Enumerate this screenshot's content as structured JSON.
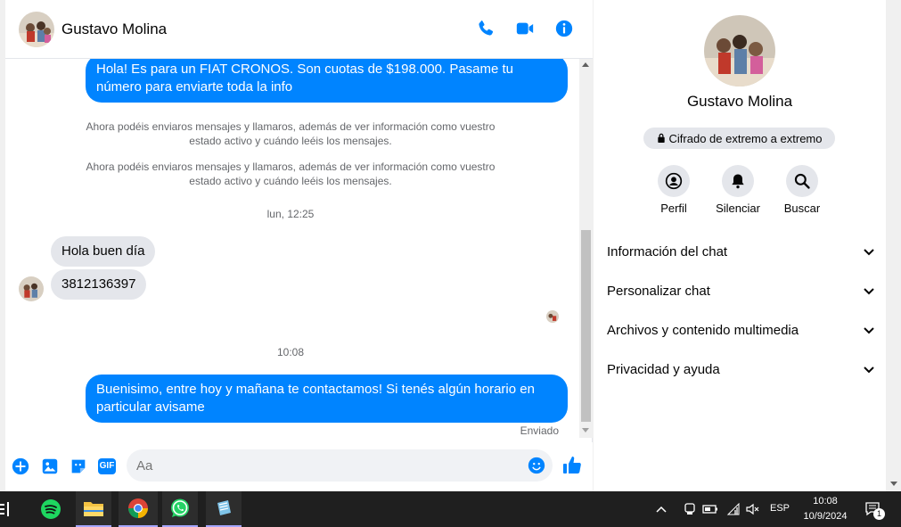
{
  "contact": {
    "name": "Gustavo Molina"
  },
  "header": {
    "icons": [
      "phone-icon",
      "video-camera-icon",
      "info-icon"
    ]
  },
  "messages": {
    "out1": "Hola! Es para un FIAT CRONOS. Son cuotas de $198.000. Pasame tu número para enviarte toda la info",
    "sys1": "Ahora podéis enviaros mensajes y llamaros, además de ver información como vuestro estado activo y cuándo leéis los mensajes.",
    "sys2": "Ahora podéis enviaros mensajes y llamaros, además de ver información como vuestro estado activo y cuándo leéis los mensajes.",
    "time1": "lun, 12:25",
    "in1": "Hola buen día",
    "in2": "3812136397",
    "time2": "10:08",
    "out2": "Buenisimo, entre hoy y mañana te contactamos! Si tenés algún horario en particular avisame",
    "status": "Enviado"
  },
  "composer": {
    "placeholder": "Aa",
    "gif_label": "GIF"
  },
  "info_panel": {
    "encryption": "Cifrado de extremo a extremo",
    "actions": [
      {
        "label": "Perfil",
        "icon": "profile-icon"
      },
      {
        "label": "Silenciar",
        "icon": "bell-icon"
      },
      {
        "label": "Buscar",
        "icon": "search-icon"
      }
    ],
    "sections": [
      "Información del chat",
      "Personalizar chat",
      "Archivos y contenido multimedia",
      "Privacidad y ayuda"
    ]
  },
  "taskbar": {
    "apps": [
      "spotify-icon",
      "file-explorer-icon",
      "chrome-icon",
      "whatsapp-icon",
      "notepad-icon"
    ],
    "language": "ESP",
    "time": "10:08",
    "date": "10/9/2024",
    "notification_count": "1"
  },
  "colors": {
    "accent": "#0084ff",
    "bubble_in": "#e4e6eb",
    "taskbar": "#1f1f1f"
  }
}
